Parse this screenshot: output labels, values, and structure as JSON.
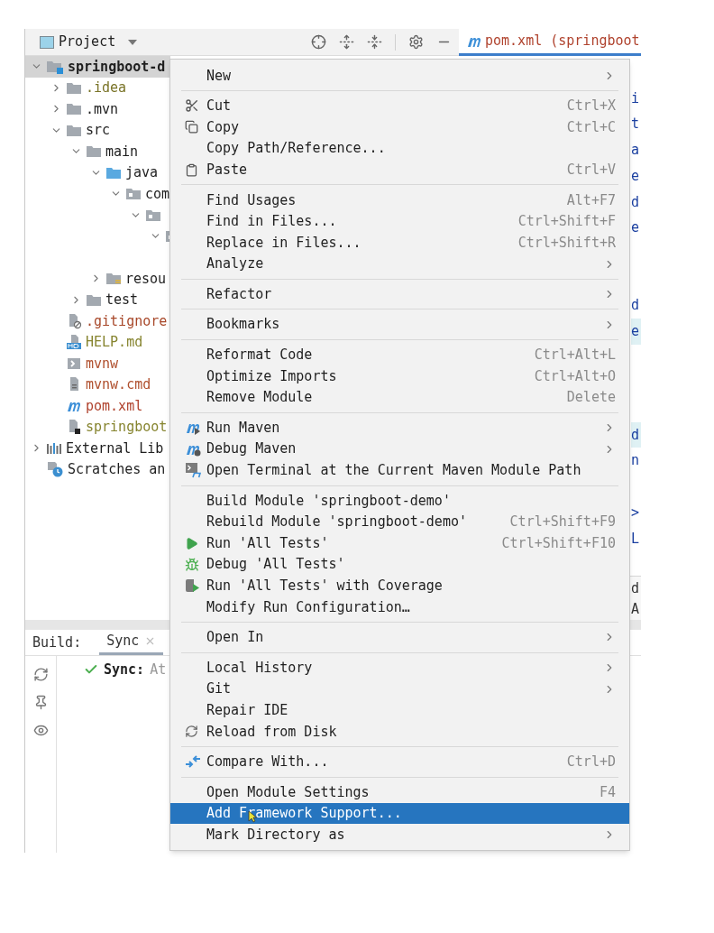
{
  "project_panel": {
    "title": "Project"
  },
  "tree": [
    {
      "label": "springboot-d",
      "kind": "module",
      "color": "#1f1f1f",
      "selected": true,
      "expanded": true,
      "children": [
        {
          "label": ".idea",
          "kind": "folder",
          "color": "#7a7428",
          "selected": false,
          "expanded": false
        },
        {
          "label": ".mvn",
          "kind": "folder",
          "color": "#1f1f1f",
          "selected": false,
          "expanded": false
        },
        {
          "label": "src",
          "kind": "folder",
          "color": "#1f1f1f",
          "selected": false,
          "expanded": true,
          "children": [
            {
              "label": "main",
              "kind": "folder",
              "color": "#1f1f1f",
              "selected": false,
              "expanded": true,
              "children": [
                {
                  "label": "java",
                  "kind": "source-folder",
                  "color": "#1f1f1f",
                  "selected": false,
                  "expanded": true,
                  "children": [
                    {
                      "label": "com",
                      "kind": "package",
                      "color": "#1f1f1f",
                      "selected": false,
                      "expanded": true,
                      "children": [
                        {
                          "kind": "package",
                          "selected": false,
                          "expanded": true,
                          "children": [
                            {
                              "kind": "package",
                              "selected": false,
                              "expanded": true
                            }
                          ]
                        }
                      ]
                    }
                  ]
                },
                {
                  "label": "resou",
                  "kind": "resources-folder",
                  "color": "#1f1f1f",
                  "selected": false,
                  "expanded": false
                }
              ]
            },
            {
              "label": "test",
              "kind": "folder",
              "color": "#1f1f1f",
              "selected": false,
              "expanded": false
            }
          ]
        },
        {
          "label": ".gitignore",
          "kind": "ignore-file",
          "color": "#a8482a",
          "selected": false
        },
        {
          "label": "HELP.md",
          "kind": "markdown",
          "color": "#86842f",
          "selected": false
        },
        {
          "label": "mvnw",
          "kind": "script",
          "color": "#b0502e",
          "selected": false
        },
        {
          "label": "mvnw.cmd",
          "kind": "text-file",
          "color": "#b0502e",
          "selected": false
        },
        {
          "label": "pom.xml",
          "kind": "maven",
          "color": "#b0432e",
          "selected": false
        },
        {
          "label": "springboot",
          "kind": "module-file",
          "color": "#86842f",
          "selected": false
        }
      ]
    },
    {
      "label": "External Lib",
      "kind": "libraries",
      "color": "#1f1f1f",
      "selected": false,
      "expanded": false
    },
    {
      "label": "Scratches an",
      "kind": "scratches",
      "color": "#1f1f1f",
      "selected": false
    }
  ],
  "editor": {
    "tab": "pom.xml (springboot",
    "selected": true,
    "line_blocks": [
      [
        {
          "text": "i",
          "highlighted": false
        },
        {
          "text": "t",
          "highlighted": false
        },
        {
          "text": "a",
          "highlighted": false
        },
        {
          "text": "e",
          "highlighted": false
        },
        {
          "text": "d",
          "highlighted": false
        },
        {
          "text": "e",
          "highlighted": false
        }
      ],
      [
        {
          "text": "d",
          "highlighted": false
        },
        {
          "text": "e",
          "highlighted": true
        }
      ],
      [
        {
          "text": "d",
          "highlighted": true
        },
        {
          "text": "n",
          "highlighted": false
        }
      ],
      [
        {
          "text": ">",
          "highlighted": false
        },
        {
          "text": "L",
          "highlighted": false
        }
      ]
    ],
    "lower_lines": [
      "d",
      "A"
    ]
  },
  "build_panel": {
    "label": "Build:",
    "tabs": [
      {
        "label": "Sync",
        "selected": true
      }
    ],
    "status": "Sync:",
    "detail": "At"
  },
  "context_menu": [
    [
      {
        "label": "New",
        "submenu": true,
        "selected": false
      }
    ],
    [
      {
        "label": "Cut",
        "shortcut": "Ctrl+X",
        "submenu": false,
        "selected": false
      },
      {
        "label": "Copy",
        "shortcut": "Ctrl+C",
        "submenu": false,
        "selected": false
      },
      {
        "label": "Copy Path/Reference...",
        "submenu": false,
        "selected": false
      },
      {
        "label": "Paste",
        "shortcut": "Ctrl+V",
        "submenu": false,
        "selected": false
      }
    ],
    [
      {
        "label": "Find Usages",
        "shortcut": "Alt+F7",
        "submenu": false,
        "selected": false
      },
      {
        "label": "Find in Files...",
        "shortcut": "Ctrl+Shift+F",
        "submenu": false,
        "selected": false
      },
      {
        "label": "Replace in Files...",
        "shortcut": "Ctrl+Shift+R",
        "submenu": false,
        "selected": false
      },
      {
        "label": "Analyze",
        "submenu": true,
        "selected": false
      }
    ],
    [
      {
        "label": "Refactor",
        "submenu": true,
        "selected": false
      }
    ],
    [
      {
        "label": "Bookmarks",
        "submenu": true,
        "selected": false
      }
    ],
    [
      {
        "label": "Reformat Code",
        "shortcut": "Ctrl+Alt+L",
        "submenu": false,
        "selected": false
      },
      {
        "label": "Optimize Imports",
        "shortcut": "Ctrl+Alt+O",
        "submenu": false,
        "selected": false
      },
      {
        "label": "Remove Module",
        "shortcut": "Delete",
        "submenu": false,
        "selected": false
      }
    ],
    [
      {
        "label": "Run Maven",
        "submenu": true,
        "selected": false
      },
      {
        "label": "Debug Maven",
        "submenu": true,
        "selected": false
      },
      {
        "label": "Open Terminal at the Current Maven Module Path",
        "submenu": false,
        "selected": false
      }
    ],
    [
      {
        "label": "Build Module 'springboot-demo'",
        "submenu": false,
        "selected": false
      },
      {
        "label": "Rebuild Module 'springboot-demo'",
        "shortcut": "Ctrl+Shift+F9",
        "submenu": false,
        "selected": false
      },
      {
        "label": "Run 'All Tests'",
        "shortcut": "Ctrl+Shift+F10",
        "submenu": false,
        "selected": false
      },
      {
        "label": "Debug 'All Tests'",
        "submenu": false,
        "selected": false
      },
      {
        "label": "Run 'All Tests' with Coverage",
        "submenu": false,
        "selected": false
      },
      {
        "label": "Modify Run Configuration…",
        "submenu": false,
        "selected": false
      }
    ],
    [
      {
        "label": "Open In",
        "submenu": true,
        "selected": false
      }
    ],
    [
      {
        "label": "Local History",
        "submenu": true,
        "selected": false
      },
      {
        "label": "Git",
        "submenu": true,
        "selected": false
      },
      {
        "label": "Repair IDE",
        "submenu": false,
        "selected": false
      },
      {
        "label": "Reload from Disk",
        "submenu": false,
        "selected": false
      }
    ],
    [
      {
        "label": "Compare With...",
        "shortcut": "Ctrl+D",
        "submenu": false,
        "selected": false
      }
    ],
    [
      {
        "label": "Open Module Settings",
        "shortcut": "F4",
        "submenu": false,
        "selected": false
      },
      {
        "label": "Add Framework Support...",
        "submenu": false,
        "selected": true
      },
      {
        "label": "Mark Directory as",
        "submenu": true,
        "selected": false
      }
    ]
  ]
}
